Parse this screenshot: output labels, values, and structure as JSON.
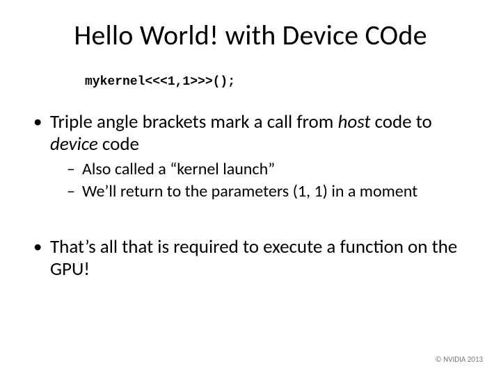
{
  "title": "Hello World! with Device COde",
  "code": "mykernel<<<1,1>>>();",
  "bullets": {
    "b1_pre": "Triple angle brackets mark a call from ",
    "b1_host": "host",
    "b1_mid": " code to ",
    "b1_device": "device",
    "b1_post": " code",
    "b1_sub1": "Also called a “kernel launch”",
    "b1_sub2": "We’ll return to the parameters (1, 1) in a moment",
    "b2": "That’s all that is required to execute a function on the GPU!"
  },
  "footer": "© NVIDIA 2013"
}
